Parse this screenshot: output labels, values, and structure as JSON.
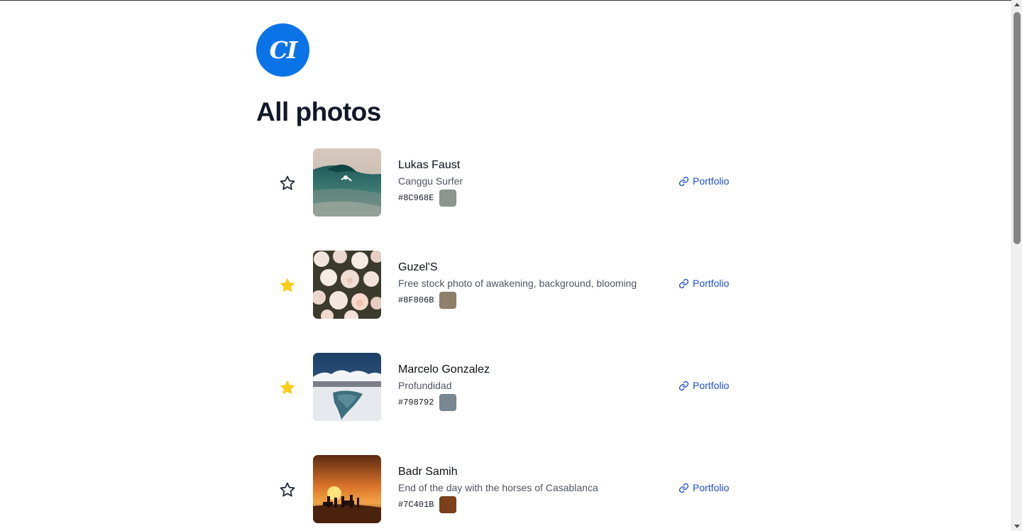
{
  "logo": {
    "text": "CI",
    "color": "#0a73e8"
  },
  "page_title": "All photos",
  "portfolio_label": "Portfolio",
  "photos": [
    {
      "name": "Lukas Faust",
      "description": "Canggu Surfer",
      "hex": "#8C968E",
      "starred": false
    },
    {
      "name": "Guzel'S",
      "description": "Free stock photo of awakening, background, blooming",
      "hex": "#8F806B",
      "starred": true
    },
    {
      "name": "Marcelo Gonzalez",
      "description": "Profundidad",
      "hex": "#798792",
      "starred": true
    },
    {
      "name": "Badr Samih",
      "description": "End of the day with the horses of Casablanca",
      "hex": "#7C401B",
      "starred": false
    }
  ],
  "icons": {
    "star_outline": "star-outline-icon",
    "star_filled": "star-filled-icon",
    "link": "link-icon"
  },
  "colors": {
    "star_filled": "#FACC15",
    "link": "#1D4ED8"
  }
}
